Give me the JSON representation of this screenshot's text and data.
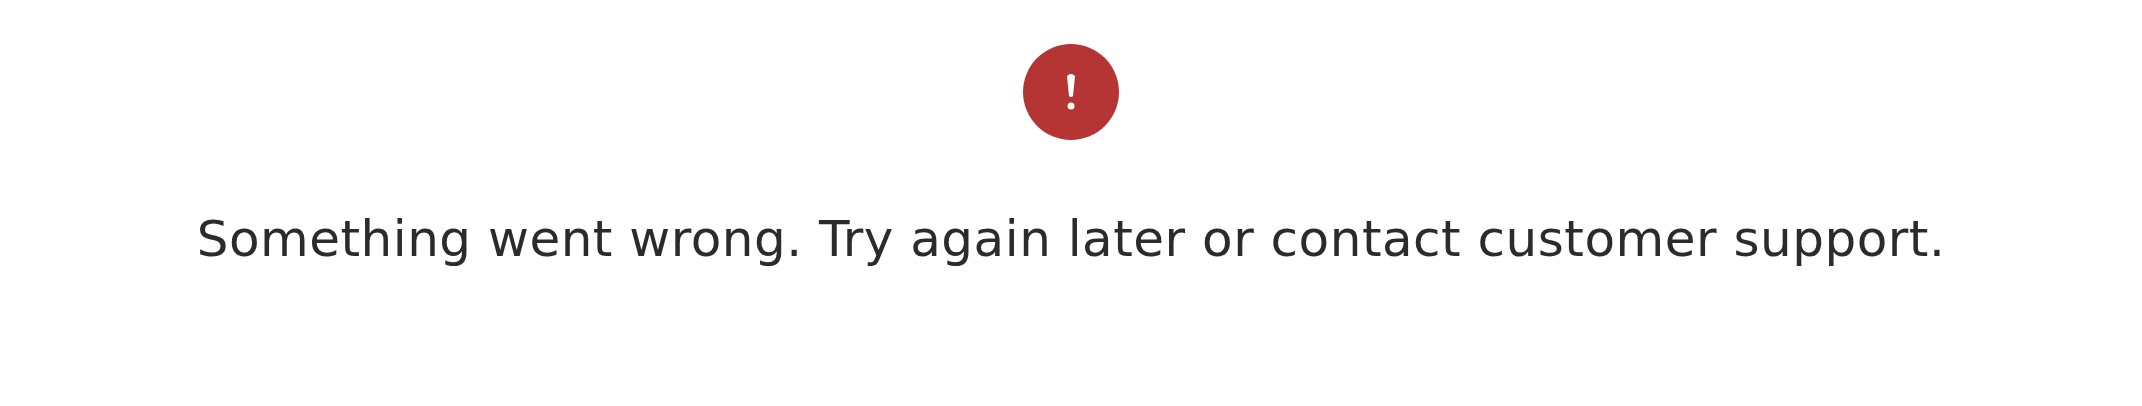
{
  "error": {
    "message": "Something went wrong. Try again later or contact customer support."
  }
}
